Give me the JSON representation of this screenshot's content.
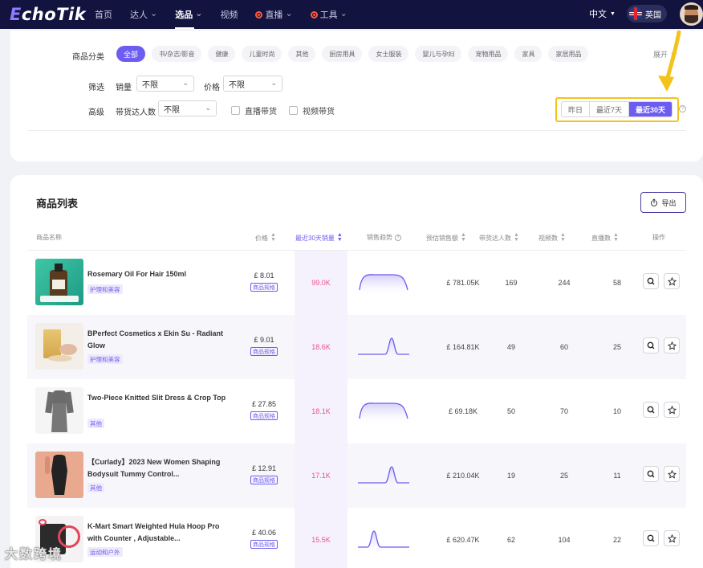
{
  "nav": {
    "logo": "EchoTik",
    "items": [
      {
        "label": "首页",
        "active": false,
        "dropdown": false
      },
      {
        "label": "达人",
        "active": false,
        "dropdown": true
      },
      {
        "label": "选品",
        "active": true,
        "dropdown": true
      },
      {
        "label": "视频",
        "active": false,
        "dropdown": false
      },
      {
        "label": "直播",
        "active": false,
        "dropdown": true,
        "live": true
      },
      {
        "label": "工具",
        "active": false,
        "dropdown": true,
        "live": true
      }
    ],
    "language": "中文",
    "country": "英国"
  },
  "filters": {
    "category_label": "商品分类",
    "categories": [
      "全部",
      "书/杂志/影音",
      "健康",
      "儿童时尚",
      "其他",
      "厨房用具",
      "女士服装",
      "婴儿与孕妇",
      "宠物用品",
      "家具",
      "家居用品"
    ],
    "active_category": "全部",
    "expand_label": "展开",
    "screen_label": "筛选",
    "sales_label": "销量",
    "sales_value": "不限",
    "price_label": "价格",
    "price_value": "不限",
    "advanced_label": "高级",
    "influencer_count_label": "带货达人数",
    "influencer_count_value": "不限",
    "live_label": "直播带货",
    "video_label": "视频带货",
    "date_options": [
      "昨日",
      "最近7天",
      "最近30天"
    ],
    "active_date": "最近30天"
  },
  "list": {
    "title": "商品列表",
    "export_label": "导出",
    "columns": {
      "name": "商品名称",
      "price": "价格",
      "sales30": "最近30天销量",
      "trend": "销售趋势",
      "revenue": "预估销售额",
      "influencers": "带货达人数",
      "videos": "视频数",
      "lives": "直播数",
      "actions": "操作"
    },
    "spec_label": "商品规格",
    "rows": [
      {
        "name": "Rosemary Oil For Hair 150ml",
        "category": "护理和美容",
        "price": "£ 8.01",
        "sales": "99.0K",
        "revenue": "£ 781.05K",
        "influencers": "169",
        "videos": "244",
        "lives": "58",
        "trend": "plateau"
      },
      {
        "name": "BPerfect Cosmetics x Ekin Su - Radiant Glow",
        "category": "护理和美容",
        "price": "£ 9.01",
        "sales": "18.6K",
        "revenue": "£ 164.81K",
        "influencers": "49",
        "videos": "60",
        "lives": "25",
        "trend": "peak-right"
      },
      {
        "name": "Two-Piece Knitted Slit Dress & Crop Top",
        "category": "其他",
        "price": "£ 27.85",
        "sales": "18.1K",
        "revenue": "£ 69.18K",
        "influencers": "50",
        "videos": "70",
        "lives": "10",
        "trend": "plateau"
      },
      {
        "name": "【Curlady】2023 New Women Shaping Bodysuit Tummy Control...",
        "category": "其他",
        "price": "£ 12.91",
        "sales": "17.1K",
        "revenue": "£ 210.04K",
        "influencers": "19",
        "videos": "25",
        "lives": "11",
        "trend": "peak-right"
      },
      {
        "name": "K-Mart Smart Weighted Hula Hoop Pro with Counter , Adjustable...",
        "category": "运动和户外",
        "price": "£ 40.06",
        "sales": "15.5K",
        "revenue": "£ 620.47K",
        "influencers": "62",
        "videos": "104",
        "lives": "22",
        "trend": "peak-left"
      }
    ]
  },
  "watermark": "大数跨境",
  "colors": {
    "nav_bg": "#12133f",
    "accent": "#6c5cf0",
    "sales": "#e8518f",
    "highlight": "#f3c31b"
  }
}
